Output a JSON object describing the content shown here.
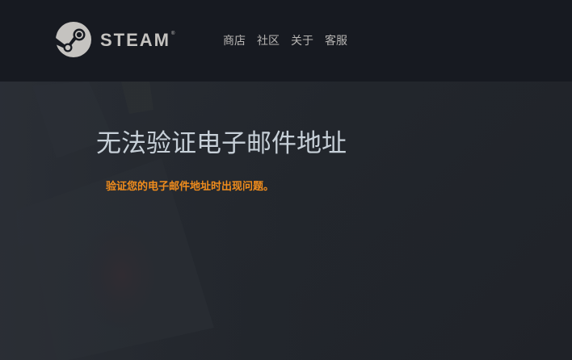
{
  "header": {
    "brand": "STEAM",
    "brand_mark": "®",
    "nav": [
      "商店",
      "社区",
      "关于",
      "客服"
    ]
  },
  "main": {
    "title": "无法验证电子邮件地址",
    "message": "验证您的电子邮件地址时出现问题。"
  },
  "colors": {
    "header_bg": "#171a21",
    "title": "#c7d0d8",
    "message": "#f08c1c"
  },
  "icons": [
    "steam-logo-icon"
  ]
}
